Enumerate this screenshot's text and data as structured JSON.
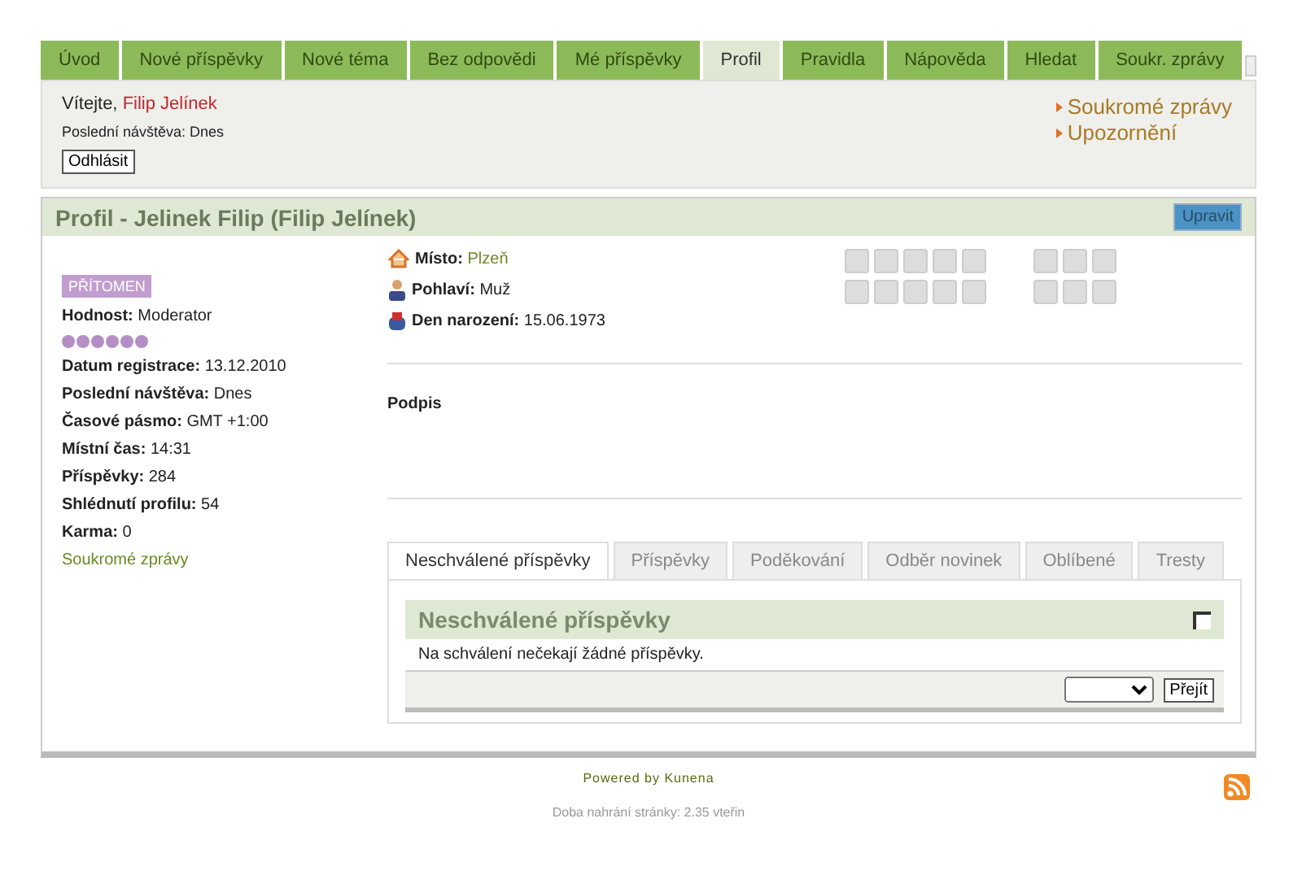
{
  "menu": [
    {
      "label": "Úvod",
      "selected": false
    },
    {
      "label": "Nové příspěvky",
      "selected": false
    },
    {
      "label": "Nové téma",
      "selected": false
    },
    {
      "label": "Bez odpovědi",
      "selected": false
    },
    {
      "label": "Mé příspěvky",
      "selected": false
    },
    {
      "label": "Profil",
      "selected": true
    },
    {
      "label": "Pravidla",
      "selected": false
    },
    {
      "label": "Nápověda",
      "selected": false
    },
    {
      "label": "Hledat",
      "selected": false
    },
    {
      "label": "Soukr. zprávy",
      "selected": false
    }
  ],
  "welcome": {
    "greeting": "Vítejte,",
    "user": "Filip Jelínek",
    "last_visit": "Poslední návštěva: Dnes",
    "logout": "Odhlásit",
    "links": [
      "Soukromé zprávy",
      "Upozornění"
    ]
  },
  "profile": {
    "title": "Profil - Jelinek Filip (Filip Jelínek)",
    "edit": "Upravit",
    "status": "PŘÍTOMEN",
    "rank_label": "Hodnost:",
    "rank": "Moderator",
    "stars": 6,
    "stats": [
      {
        "label": "Datum registrace:",
        "value": "13.12.2010"
      },
      {
        "label": "Poslední návštěva:",
        "value": "Dnes"
      },
      {
        "label": "Časové pásmo:",
        "value": "GMT +1:00"
      },
      {
        "label": "Místní čas:",
        "value": "14:31"
      },
      {
        "label": "Příspěvky:",
        "value": "284"
      },
      {
        "label": "Shlédnutí profilu:",
        "value": "54"
      },
      {
        "label": "Karma:",
        "value": "0"
      }
    ],
    "pm_link": "Soukromé zprávy",
    "details": [
      {
        "kind": "home",
        "label": "Místo:",
        "value": "Plzeň",
        "link": true
      },
      {
        "kind": "person",
        "label": "Pohlaví:",
        "value": "Muž",
        "link": false
      },
      {
        "kind": "cake",
        "label": "Den narození:",
        "value": "15.06.1973",
        "link": false
      }
    ],
    "signature": "Podpis"
  },
  "tabs": [
    {
      "label": "Neschválené příspěvky",
      "selected": true
    },
    {
      "label": "Příspěvky",
      "selected": false
    },
    {
      "label": "Poděkování",
      "selected": false
    },
    {
      "label": "Odběr novinek",
      "selected": false
    },
    {
      "label": "Oblíbené",
      "selected": false
    },
    {
      "label": "Tresty",
      "selected": false
    }
  ],
  "panel": {
    "title": "Neschválené příspěvky",
    "checked": false,
    "message": "Na schválení nečekají žádné příspěvky.",
    "go": "Přejít"
  },
  "footer": {
    "powered": "Powered by Kunena",
    "load_time": "Doba nahrání stránky: 2.35 vteřin"
  }
}
